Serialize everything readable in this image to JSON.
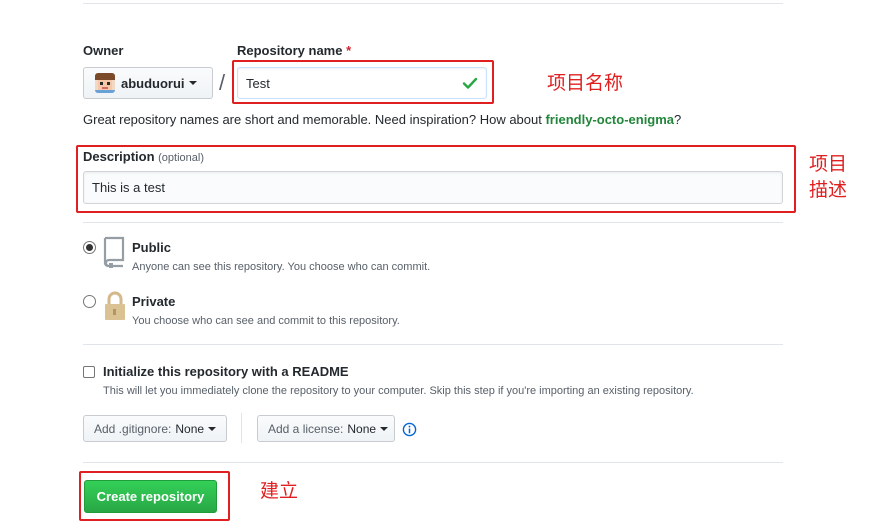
{
  "owner": {
    "label": "Owner",
    "username": "abuduorui"
  },
  "separator": "/",
  "repo_name": {
    "label": "Repository name",
    "required_mark": "*",
    "value": "Test"
  },
  "hint": {
    "prefix": "Great repository names are short and memorable. Need inspiration? How about ",
    "suggestion": "friendly-octo-enigma",
    "suffix": "?"
  },
  "description": {
    "label": "Description",
    "optional": "(optional)",
    "value": "This is a test"
  },
  "visibility": {
    "public": {
      "title": "Public",
      "note": "Anyone can see this repository. You choose who can commit.",
      "checked": true
    },
    "private": {
      "title": "Private",
      "note": "You choose who can see and commit to this repository.",
      "checked": false
    }
  },
  "readme": {
    "title": "Initialize this repository with a README",
    "note": "This will let you immediately clone the repository to your computer. Skip this step if you're importing an existing repository."
  },
  "gitignore": {
    "label": "Add .gitignore:",
    "value": "None"
  },
  "license": {
    "label": "Add a license:",
    "value": "None"
  },
  "create_button": "Create repository",
  "annotations": {
    "name": "项目名称",
    "desc_line1": "项目",
    "desc_line2": "描述",
    "create": "建立"
  },
  "colors": {
    "accent_green": "#2cbe4e",
    "suggestion_green": "#22863a",
    "annotation_red": "#e02020"
  }
}
